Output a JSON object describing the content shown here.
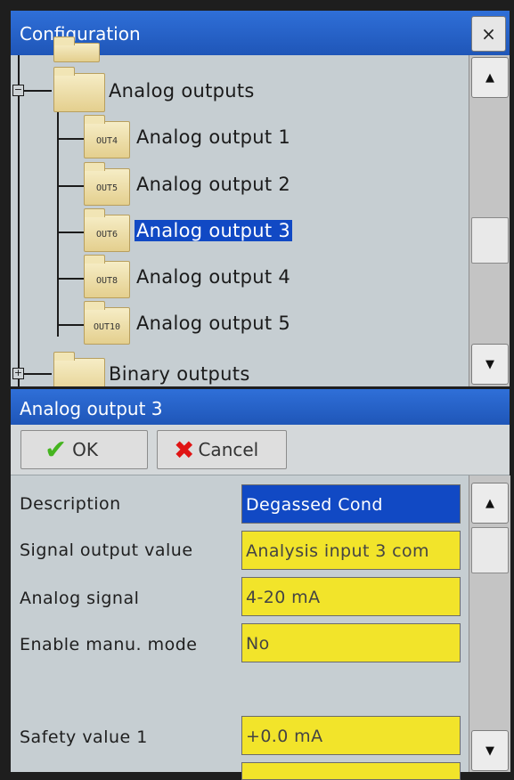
{
  "config_window": {
    "title": "Configuration",
    "close_symbol": "×",
    "scroll_up": "▲",
    "scroll_down": "▼",
    "scroll_position": 0.72,
    "tree": {
      "parent_label": "Analog outputs",
      "parent_expander": "−",
      "children": [
        {
          "tag": "OUT4",
          "label": "Analog output 1",
          "selected": false
        },
        {
          "tag": "OUT5",
          "label": "Analog output 2",
          "selected": false
        },
        {
          "tag": "OUT6",
          "label": "Analog output 3",
          "selected": true
        },
        {
          "tag": "OUT8",
          "label": "Analog output 4",
          "selected": false
        },
        {
          "tag": "OUT10",
          "label": "Analog output 5",
          "selected": false
        }
      ],
      "next_label": "Binary outputs",
      "next_expander": "+"
    }
  },
  "detail_window": {
    "title": "Analog output 3",
    "ok_label": "OK",
    "ok_icon": "check-icon",
    "cancel_label": "Cancel",
    "cancel_icon": "x-icon",
    "scroll_up": "▲",
    "scroll_down": "▼",
    "properties": [
      {
        "label": "Description",
        "value": "Degassed Cond",
        "active": true
      },
      {
        "label": "Signal output value",
        "value": "Analysis input 3 com",
        "active": false
      },
      {
        "label": "Analog signal",
        "value": "4-20 mA",
        "active": false
      },
      {
        "label": "Enable manu. mode",
        "value": "No",
        "active": false
      },
      {
        "label": "Safety value 1",
        "value": "+0.0 mA",
        "active": false
      }
    ]
  },
  "colors": {
    "titlebar": "#2f6fd8",
    "selection": "#1149c4",
    "field_yellow": "#f2e42a",
    "panel_bg": "#c6ced2"
  }
}
